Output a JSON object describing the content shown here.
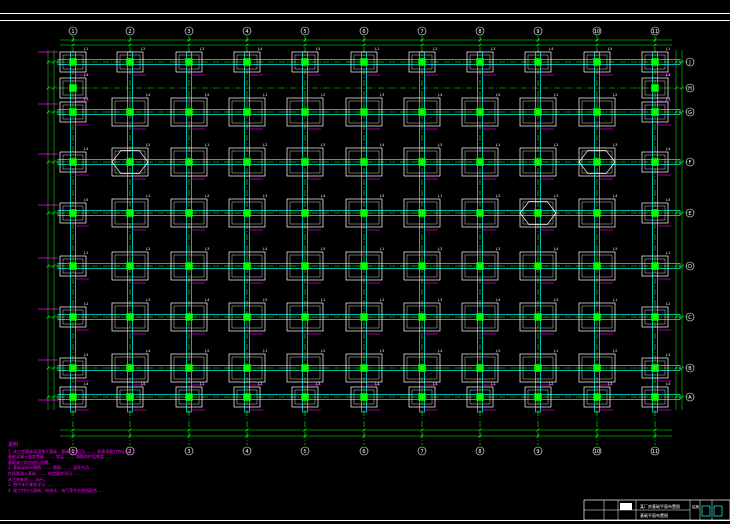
{
  "colors": {
    "background": "#000000",
    "frame": "#ffffff",
    "grid": "#00ff00",
    "beam": "#00e0e0",
    "footing": "#ffffff",
    "column": "#00ff00",
    "notes": "#ff00ff",
    "dims": "#00ff00"
  },
  "drawing": {
    "grid_columns": [
      "1",
      "2",
      "3",
      "4",
      "5",
      "6",
      "7",
      "8",
      "9",
      "10",
      "11"
    ],
    "grid_rows": [
      "A",
      "B",
      "C",
      "D",
      "E",
      "F",
      "G",
      "H",
      "J"
    ],
    "footing_labels": [
      "J-1",
      "J-2",
      "J-3",
      "J-4",
      "J-5"
    ]
  },
  "notes": {
    "heading": "说明：",
    "lines": [
      "1. 本工程基础采用独立基础，基础持力层为……，地基承载力特征值……",
      "   基础混凝土强度等级……，垫层……，钢筋保护层厚度……",
      "   基础施工前应进行验槽。",
      "2. 基础梁纵向钢筋……，箍筋……，梁柱节点……",
      "   柱插筋锚入基础……，构造要求详见……",
      "   未注明者按……执行。",
      "3. 图中未尽事宜详见……",
      "4. 施工时应与建筑、给排水、电气等专业图纸配合……"
    ]
  },
  "title_block": {
    "project": "某厂房基础平面布置图",
    "drawing_title": "基础平面布置图",
    "sheet": "结施"
  }
}
